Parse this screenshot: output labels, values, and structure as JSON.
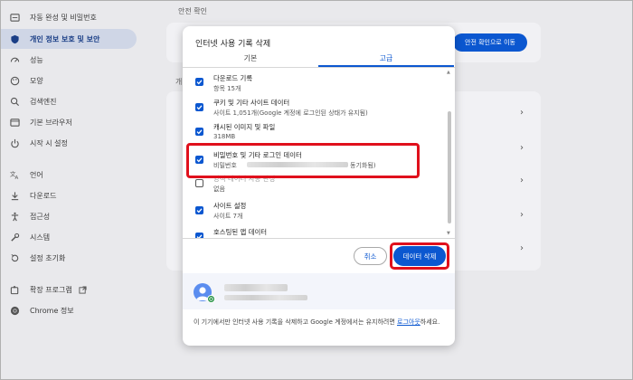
{
  "sidebar": {
    "items": [
      {
        "label": "자동 완성 및 비밀번호",
        "icon": "autofill-icon",
        "active": false
      },
      {
        "label": "개인 정보 보호 및 보안",
        "icon": "shield-icon",
        "active": true
      },
      {
        "label": "성능",
        "icon": "performance-icon",
        "active": false
      },
      {
        "label": "모양",
        "icon": "palette-icon",
        "active": false
      },
      {
        "label": "검색엔진",
        "icon": "search-icon",
        "active": false
      },
      {
        "label": "기본 브라우저",
        "icon": "browser-icon",
        "active": false
      },
      {
        "label": "시작 시 설정",
        "icon": "power-icon",
        "active": false
      },
      {
        "label": "언어",
        "icon": "translate-icon",
        "active": false
      },
      {
        "label": "다운로드",
        "icon": "download-icon",
        "active": false
      },
      {
        "label": "접근성",
        "icon": "accessibility-icon",
        "active": false
      },
      {
        "label": "시스템",
        "icon": "wrench-icon",
        "active": false
      },
      {
        "label": "설정 초기화",
        "icon": "reset-icon",
        "active": false
      },
      {
        "label": "확장 프로그램",
        "icon": "extension-icon",
        "active": false
      },
      {
        "label": "Chrome 정보",
        "icon": "chrome-icon",
        "active": false
      }
    ]
  },
  "main": {
    "section_title": "안전 확인",
    "safety_button": "안전 확인으로 이동",
    "side_letter": "개"
  },
  "dialog": {
    "title": "인터넷 사용 기록 삭제",
    "tabs": [
      {
        "label": "기본",
        "selected": false
      },
      {
        "label": "고급",
        "selected": true
      }
    ],
    "options": [
      {
        "title": "다운로드 기록",
        "subtitle": "항목 15개",
        "checked": true
      },
      {
        "title": "쿠키 및 기타 사이트 데이터",
        "subtitle": "사이트 1,051개(Google 계정에 로그인된 상태가 유지됨)",
        "checked": true
      },
      {
        "title": "캐시된 이미지 및 파일",
        "subtitle": "318MB",
        "checked": true
      },
      {
        "title": "비밀번호 및 기타 로그인 데이터",
        "subtitle_prefix": "비밀번호",
        "subtitle_suffix": "동기화됨)",
        "checked": true
      },
      {
        "title": "양식 데이터 자동 완성",
        "subtitle": "없음",
        "checked": false
      },
      {
        "title": "사이트 설정",
        "subtitle": "사이트 7개",
        "checked": true
      },
      {
        "title": "호스팅된 앱 데이터",
        "subtitle": "",
        "checked": true
      }
    ],
    "cancel_button": "취소",
    "delete_button": "데이터 삭제",
    "footer_text": "이 기기에서만 인터넷 사용 기록을 삭제하고 Google 계정에서는 유지하려면 ",
    "footer_link": "로그아웃",
    "footer_suffix": "하세요."
  },
  "colors": {
    "accent": "#0b57d0",
    "highlight": "#e0101c",
    "sidebar_active_bg": "#cfd6e6"
  }
}
